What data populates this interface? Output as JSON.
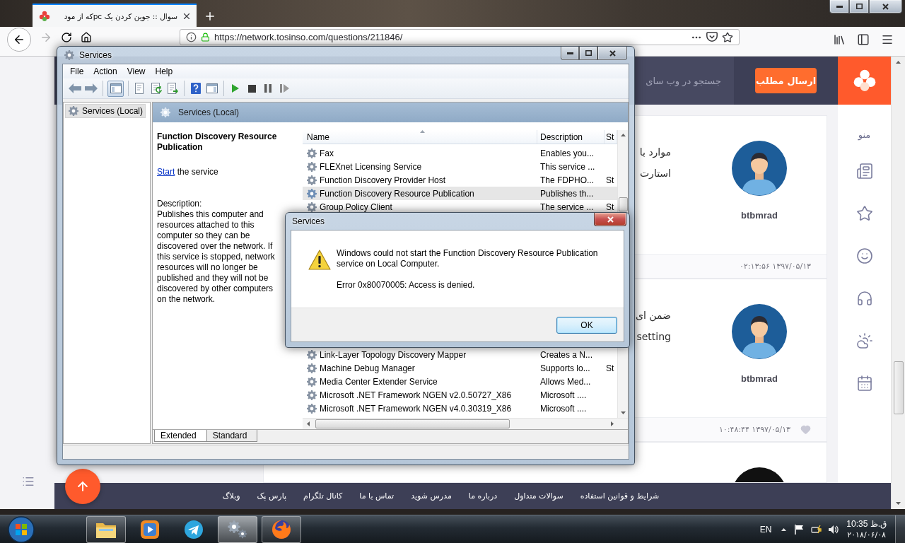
{
  "browser": {
    "tab": {
      "title": "سوال :: جوین کردن یک pcکه از مود",
      "selected": true
    },
    "nav": {
      "back": {
        "disabled": false
      },
      "forward": {
        "disabled": true
      }
    },
    "url": "https://network.tosinso.com/questions/211846/"
  },
  "site": {
    "search": {
      "placeholder": "جستجو در وب سای"
    },
    "submit_button": "ارسال مطلب",
    "menu_label": "منو",
    "posts": [
      {
        "kind": "illustration",
        "lines": [
          "موارد با",
          "استارت"
        ],
        "author": "btbmrad",
        "date": "۰۲:۱۳:۵۶ ۱۳۹۷/۰۵/۱۳",
        "like_icon": false
      },
      {
        "kind": "illustration",
        "lines": [
          "ضمن ای",
          "setting"
        ],
        "author": "btbmrad",
        "date": "۱۰:۴۸:۴۴ ۱۳۹۷/۰۵/۱۳",
        "like_icon": true
      },
      {
        "kind": "photo"
      }
    ],
    "footer_links": [
      "شرایط و قوانین استفاده",
      "سوالات متداول",
      "درباره ما",
      "مدرس شوید",
      "تماس با ما",
      "کانال تلگرام",
      "پارس پک",
      "وبلاگ"
    ]
  },
  "services_window": {
    "title": "Services",
    "menu": [
      "File",
      "Action",
      "View",
      "Help"
    ],
    "toolbar": {
      "console_tree_toggle": {
        "pressed": true
      }
    },
    "tree": [
      {
        "label": "Services (Local)",
        "selected": true
      }
    ],
    "header": "Services (Local)",
    "details": {
      "title": "Function Discovery Resource Publication",
      "start_link": "Start",
      "start_rest": "the service",
      "description_label": "Description:",
      "description": "Publishes this computer and resources attached to this computer so they can be discovered over the network. If this service is stopped, network resources will no longer be published and they will not be discovered by other computers on the network."
    },
    "table": {
      "columns": [
        "Name",
        "Description",
        "St"
      ],
      "rows_above_dialog": [
        {
          "name": "Fax",
          "description": "Enables you...",
          "selected": false
        },
        {
          "name": "FLEXnet Licensing Service",
          "description": "This service ...",
          "selected": false
        },
        {
          "name": "Function Discovery Provider Host",
          "description": "The FDPHO...",
          "status": "St",
          "selected": false
        },
        {
          "name": "Function Discovery Resource Publication",
          "description": "Publishes th...",
          "selected": true
        },
        {
          "name": "Group Policy Client",
          "description": "The service ...",
          "status": "St",
          "selected": false
        }
      ],
      "rows_below_dialog": [
        {
          "name": "Link-Layer Topology Discovery Mapper",
          "description": "Creates a N...",
          "selected": false
        },
        {
          "name": "Machine Debug Manager",
          "description": "Supports lo...",
          "status": "St",
          "selected": false
        },
        {
          "name": "Media Center Extender Service",
          "description": "Allows Med...",
          "selected": false
        },
        {
          "name": "Microsoft .NET Framework NGEN v2.0.50727_X86",
          "description": "Microsoft ....",
          "selected": false
        },
        {
          "name": "Microsoft .NET Framework NGEN v4.0.30319_X86",
          "description": "Microsoft ....",
          "selected": false
        }
      ]
    },
    "tabs": [
      {
        "label": "Extended",
        "selected": true
      },
      {
        "label": "Standard",
        "selected": false
      }
    ]
  },
  "dialog": {
    "title": "Services",
    "message": "Windows could not start the Function Discovery Resource Publication service on Local Computer.",
    "error": "Error 0x80070005: Access is denied.",
    "ok_button": {
      "label": "OK",
      "focused": true
    }
  },
  "taskbar": {
    "apps": [
      {
        "running": true,
        "active": false
      },
      {
        "running": false,
        "active": false
      },
      {
        "running": false,
        "active": false
      },
      {
        "running": true,
        "active": true
      },
      {
        "running": true,
        "active": false
      }
    ],
    "language": "EN",
    "time": "ق.ظ 10:35",
    "date": "۲۰۱۸/۰۶/۰۸"
  }
}
